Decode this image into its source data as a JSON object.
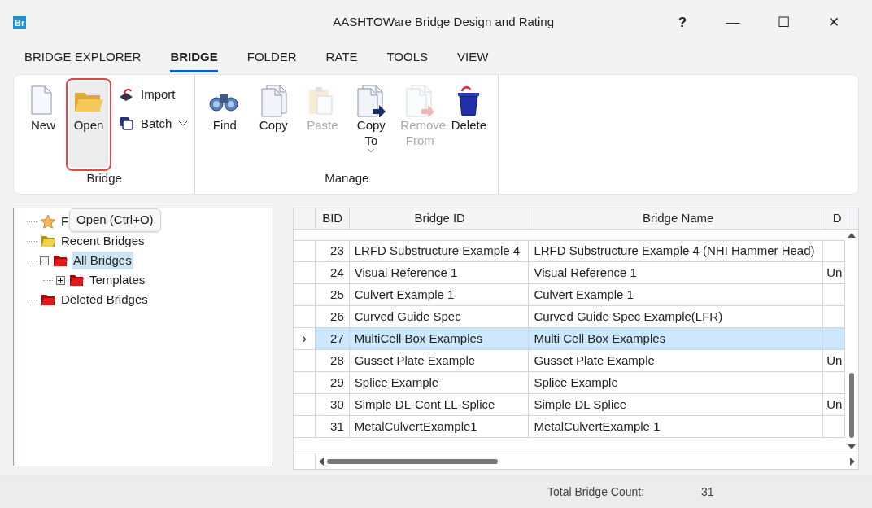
{
  "window": {
    "title": "AASHTOWare Bridge Design and Rating",
    "logo": "Br",
    "controls": [
      "?",
      "—",
      "☐",
      "✕"
    ]
  },
  "tabs": [
    {
      "label": "BRIDGE EXPLORER",
      "selected": false
    },
    {
      "label": "BRIDGE",
      "selected": true
    },
    {
      "label": "FOLDER",
      "selected": false
    },
    {
      "label": "RATE",
      "selected": false
    },
    {
      "label": "TOOLS",
      "selected": false
    },
    {
      "label": "VIEW",
      "selected": false
    }
  ],
  "ribbon": {
    "groups": [
      {
        "label": "Bridge",
        "buttons": [
          {
            "kind": "new",
            "label": "New",
            "disabled": false,
            "highlighted": false
          },
          {
            "kind": "open",
            "label": "Open",
            "disabled": false,
            "highlighted": true
          },
          {
            "kind": "import",
            "label": "Import",
            "dropdown": false
          },
          {
            "kind": "batch",
            "label": "Batch",
            "dropdown": true
          }
        ]
      },
      {
        "label": "Manage",
        "buttons": [
          {
            "kind": "find",
            "label": "Find",
            "disabled": false,
            "highlighted": false
          },
          {
            "kind": "copy",
            "label": "Copy",
            "disabled": false,
            "highlighted": false
          },
          {
            "kind": "paste",
            "label": "Paste",
            "disabled": true,
            "highlighted": false
          },
          {
            "kind": "copyto",
            "label": "Copy To",
            "disabled": false,
            "highlighted": false,
            "dropdown": true
          },
          {
            "kind": "remove",
            "label": "Remove From",
            "disabled": true,
            "highlighted": false
          },
          {
            "kind": "delete",
            "label": "Delete",
            "disabled": false,
            "highlighted": false
          }
        ]
      }
    ]
  },
  "tooltip": "Open (Ctrl+O)",
  "tree": [
    {
      "kind": "star",
      "label": "F",
      "selected": false
    },
    {
      "kind": "recent",
      "label": "Recent Bridges",
      "selected": false
    },
    {
      "kind": "folder",
      "label": "All Bridges",
      "selected": true,
      "expanded": true,
      "children": [
        {
          "kind": "folder",
          "label": "Templates",
          "selected": false,
          "expanded": false
        }
      ]
    },
    {
      "kind": "folder",
      "label": "Deleted Bridges",
      "selected": false
    }
  ],
  "table": {
    "columns": [
      "BID",
      "Bridge ID",
      "Bridge Name",
      "D"
    ],
    "rows": [
      {
        "cells": [
          "23",
          "LRFD Substructure Example 4",
          "LRFD Substructure Example 4 (NHI Hammer Head)",
          ""
        ],
        "selected": false
      },
      {
        "cells": [
          "24",
          "Visual Reference 1",
          "Visual Reference 1",
          "Un"
        ],
        "selected": false
      },
      {
        "cells": [
          "25",
          "Culvert Example 1",
          "Culvert Example 1",
          ""
        ],
        "selected": false
      },
      {
        "cells": [
          "26",
          "Curved Guide Spec",
          "Curved Guide Spec Example(LFR)",
          ""
        ],
        "selected": false
      },
      {
        "cells": [
          "27",
          "MultiCell Box Examples",
          "Multi Cell Box Examples",
          ""
        ],
        "selected": true
      },
      {
        "cells": [
          "28",
          "Gusset Plate Example",
          "Gusset Plate Example",
          "Un"
        ],
        "selected": false
      },
      {
        "cells": [
          "29",
          "Splice Example",
          "Splice Example",
          ""
        ],
        "selected": false
      },
      {
        "cells": [
          "30",
          "Simple DL-Cont LL-Splice",
          "Simple DL Splice",
          "Un"
        ],
        "selected": false
      },
      {
        "cells": [
          "31",
          "MetalCulvertExample1",
          "MetalCulvertExample 1",
          ""
        ],
        "selected": false
      }
    ],
    "row_marker": "›"
  },
  "status_bar": {
    "label": "Total Bridge Count:",
    "value": "31"
  }
}
